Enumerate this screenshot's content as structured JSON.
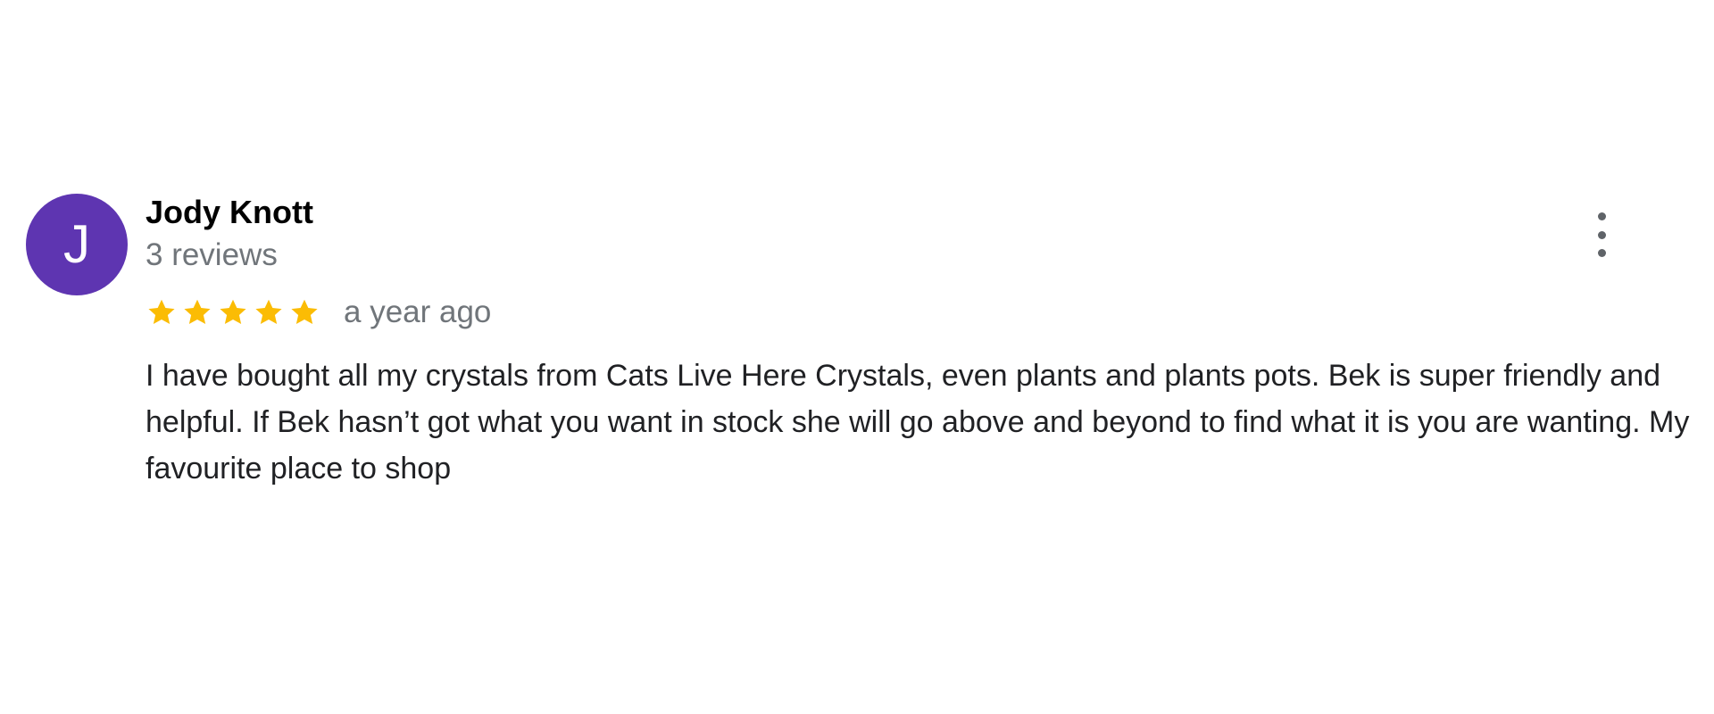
{
  "review": {
    "avatar_letter": "J",
    "avatar_color": "#5e35b1",
    "reviewer_name": "Jody Knott",
    "review_count": "3 reviews",
    "rating": 5,
    "rating_max": 5,
    "star_color": "#fbbc04",
    "date": "a year ago",
    "text": "I have bought all my crystals from Cats Live Here Crystals, even plants and plants pots. Bek is super friendly and helpful. If Bek hasn’t got what you want in stock she will go above and beyond to find what it is you are wanting. My favourite place to shop",
    "more_icon": "more-vert-icon"
  }
}
